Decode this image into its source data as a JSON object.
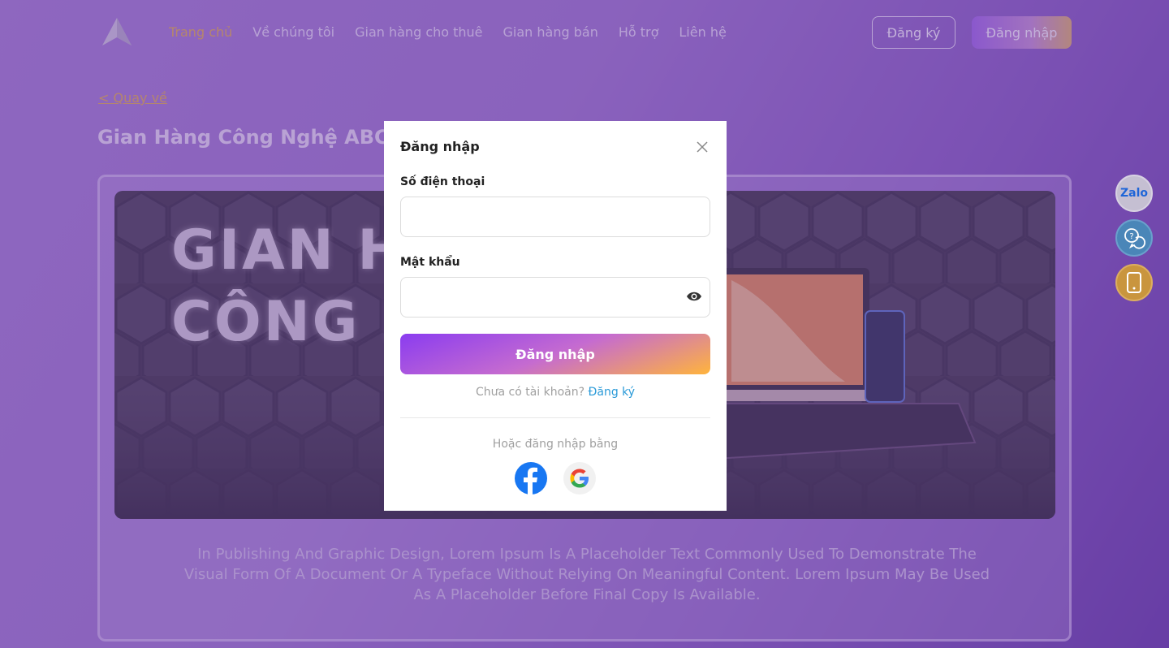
{
  "header": {
    "nav": [
      "Trang chủ",
      "Về chúng tôi",
      "Gian hàng cho thuê",
      "Gian hàng bán",
      "Hỗ trợ",
      "Liên hệ"
    ],
    "register_label": "Đăng ký",
    "login_label": "Đăng nhập"
  },
  "page": {
    "back_label": "< Quay về",
    "store_title": "Gian Hàng Công Nghệ ABC",
    "banner_line1": "GIAN H",
    "banner_line2": "CÔNG N",
    "description": "In Publishing And Graphic Design, Lorem Ipsum Is A Placeholder Text Commonly Used To Demonstrate The Visual Form Of A Document Or A Typeface Without Relying On Meaningful Content. Lorem Ipsum May Be Used As A Placeholder Before Final Copy Is Available."
  },
  "side_buttons": {
    "zalo_label": "Zalo"
  },
  "modal": {
    "title": "Đăng nhập",
    "phone_label": "Số điện thoại",
    "phone_value": "",
    "password_label": "Mật khẩu",
    "password_value": "",
    "submit_label": "Đăng nhập",
    "no_account_text": "Chưa có tài khoản?",
    "signup_link": "Đăng ký",
    "alt_login_text": "Hoặc đăng nhập bằng"
  },
  "colors": {
    "accent_gold": "#e8b23a",
    "facebook": "#1877f2",
    "link": "#2a9ad8"
  }
}
